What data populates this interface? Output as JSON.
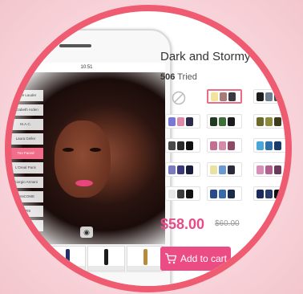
{
  "product": {
    "title": "Dark and Stormy",
    "tried_count": "506",
    "tried_label": "Tried",
    "price": "$58.00",
    "old_price": "$60.00",
    "add_to_cart_label": "Add to cart"
  },
  "phone": {
    "status_time": "10:51",
    "brands": [
      "Estee Lauder",
      "Elizabeth Arden",
      "M.A.C.",
      "Laura Geller",
      "Too Faced",
      "L'Oreal Paris",
      "Giorgio Armani",
      "LANCOME",
      "NARS",
      "No Edition"
    ],
    "thumb_labels": [
      "",
      "",
      "",
      ""
    ]
  },
  "colors": {
    "accent": "#ea4c83",
    "ring": "#ef5b70"
  }
}
